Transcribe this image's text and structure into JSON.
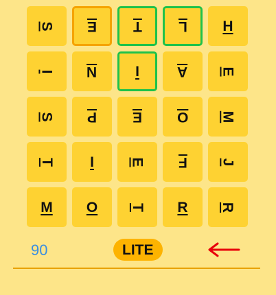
{
  "colors": {
    "background": "#fde589",
    "tile": "#fed232",
    "selected_first": "#f5a300",
    "selected_path": "#1ec24a",
    "score": "#3a8ee0",
    "mode_badge": "#fdb301",
    "backspace_arrow": "#e8000b",
    "divider": "#e8a200"
  },
  "board": {
    "rows": [
      [
        {
          "letter": "S",
          "rotation": 90,
          "selected": "none"
        },
        {
          "letter": "E",
          "rotation": 180,
          "selected": "first"
        },
        {
          "letter": "T",
          "rotation": 180,
          "selected": "path"
        },
        {
          "letter": "L",
          "rotation": 180,
          "selected": "path"
        },
        {
          "letter": "H",
          "rotation": 0,
          "selected": "none"
        }
      ],
      [
        {
          "letter": "I",
          "rotation": 90,
          "selected": "none"
        },
        {
          "letter": "N",
          "rotation": 180,
          "selected": "none"
        },
        {
          "letter": "I",
          "rotation": 0,
          "selected": "path"
        },
        {
          "letter": "A",
          "rotation": 180,
          "selected": "none"
        },
        {
          "letter": "E",
          "rotation": 90,
          "selected": "none"
        }
      ],
      [
        {
          "letter": "S",
          "rotation": 90,
          "selected": "none"
        },
        {
          "letter": "P",
          "rotation": 180,
          "selected": "none"
        },
        {
          "letter": "E",
          "rotation": 180,
          "selected": "none"
        },
        {
          "letter": "O",
          "rotation": 180,
          "selected": "none"
        },
        {
          "letter": "M",
          "rotation": 90,
          "selected": "none"
        }
      ],
      [
        {
          "letter": "T",
          "rotation": 90,
          "selected": "none"
        },
        {
          "letter": "I",
          "rotation": 0,
          "selected": "none"
        },
        {
          "letter": "E",
          "rotation": 90,
          "selected": "none"
        },
        {
          "letter": "F",
          "rotation": 180,
          "selected": "none"
        },
        {
          "letter": "J",
          "rotation": 90,
          "selected": "none"
        }
      ],
      [
        {
          "letter": "M",
          "rotation": 0,
          "selected": "none"
        },
        {
          "letter": "O",
          "rotation": 0,
          "selected": "none"
        },
        {
          "letter": "T",
          "rotation": 90,
          "selected": "none"
        },
        {
          "letter": "R",
          "rotation": 0,
          "selected": "none"
        },
        {
          "letter": "R",
          "rotation": 90,
          "selected": "none"
        }
      ]
    ]
  },
  "footer": {
    "score": "90",
    "mode_label": "LITE",
    "backspace_icon": "left-arrow-icon"
  }
}
